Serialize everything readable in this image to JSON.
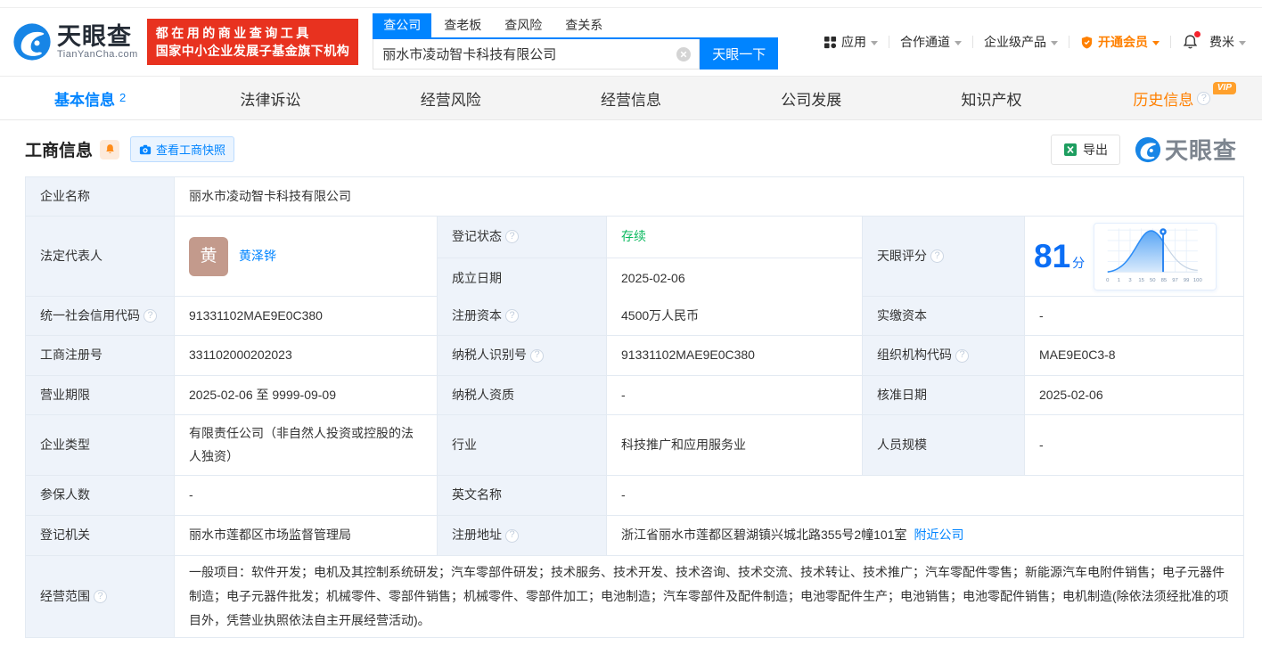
{
  "colors": {
    "primary_blue": "#0084ff",
    "brand_red": "#e8321f",
    "vip_orange": "#ff8000",
    "status_green": "#0bb95f"
  },
  "header": {
    "logo_brand": "天眼查",
    "logo_domain": "TianYanCha.com",
    "slogan_line1": "都在用的商业查询工具",
    "slogan_line2": "国家中小企业发展子基金旗下机构",
    "search_tabs": [
      {
        "label": "查公司"
      },
      {
        "label": "查老板"
      },
      {
        "label": "查风险"
      },
      {
        "label": "查关系"
      }
    ],
    "search_value": "丽水市凌动智卡科技有限公司",
    "search_button": "天眼一下",
    "menu": {
      "apps": "应用",
      "partner": "合作通道",
      "enterprise": "企业级产品",
      "vip": "开通会员",
      "user": "费米"
    }
  },
  "nav_tabs": [
    {
      "label": "基本信息",
      "count": "2"
    },
    {
      "label": "法律诉讼"
    },
    {
      "label": "经营风险"
    },
    {
      "label": "经营信息"
    },
    {
      "label": "公司发展"
    },
    {
      "label": "知识产权"
    },
    {
      "label": "历史信息",
      "vip_badge": "VIP"
    }
  ],
  "section": {
    "title": "工商信息",
    "snapshot_button": "查看工商快照",
    "export_button": "导出",
    "watermark_brand": "天眼查"
  },
  "chart_data": {
    "type": "line",
    "title": "天眼评分",
    "score": "81",
    "unit": "分",
    "x_ticks": [
      "0",
      "1",
      "3",
      "15",
      "50",
      "85",
      "97",
      "99",
      "100"
    ],
    "marker_value": 81,
    "curve": "bell-distribution",
    "xlim": [
      0,
      100
    ]
  },
  "table": {
    "company_name": {
      "label": "企业名称",
      "value": "丽水市凌动智卡科技有限公司"
    },
    "legal_rep": {
      "label": "法定代表人",
      "avatar_char": "黄",
      "name": "黄泽铧"
    },
    "reg_status": {
      "label": "登记状态",
      "value": "存续"
    },
    "est_date": {
      "label": "成立日期",
      "value": "2025-02-06"
    },
    "score": {
      "label": "天眼评分"
    },
    "credit_code": {
      "label": "统一社会信用代码",
      "value": "91331102MAE9E0C380"
    },
    "reg_capital": {
      "label": "注册资本",
      "value": "4500万人民币"
    },
    "paid_capital": {
      "label": "实缴资本",
      "value": "-"
    },
    "reg_no": {
      "label": "工商注册号",
      "value": "331102000202023"
    },
    "taxpayer_id": {
      "label": "纳税人识别号",
      "value": "91331102MAE9E0C380"
    },
    "org_code": {
      "label": "组织机构代码",
      "value": "MAE9E0C3-8"
    },
    "term": {
      "label": "营业期限",
      "value": "2025-02-06 至 9999-09-09"
    },
    "taxpayer_quality": {
      "label": "纳税人资质",
      "value": "-"
    },
    "approval_date": {
      "label": "核准日期",
      "value": "2025-02-06"
    },
    "company_type": {
      "label": "企业类型",
      "value": "有限责任公司（非自然人投资或控股的法人独资）"
    },
    "industry": {
      "label": "行业",
      "value": "科技推广和应用服务业"
    },
    "staff_size": {
      "label": "人员规模",
      "value": "-"
    },
    "insured": {
      "label": "参保人数",
      "value": "-"
    },
    "english_name": {
      "label": "英文名称",
      "value": "-"
    },
    "authority": {
      "label": "登记机关",
      "value": "丽水市莲都区市场监督管理局"
    },
    "address": {
      "label": "注册地址",
      "value": "浙江省丽水市莲都区碧湖镇兴城北路355号2幢101室",
      "link": "附近公司"
    },
    "scope": {
      "label": "经营范围",
      "value": "一般项目：软件开发；电机及其控制系统研发；汽车零部件研发；技术服务、技术开发、技术咨询、技术交流、技术转让、技术推广；汽车零配件零售；新能源汽车电附件销售；电子元器件制造；电子元器件批发；机械零件、零部件销售；机械零件、零部件加工；电池制造；汽车零部件及配件制造；电池零配件生产；电池销售；电池零配件销售；电机制造(除依法须经批准的项目外，凭营业执照依法自主开展经营活动)。"
    }
  }
}
